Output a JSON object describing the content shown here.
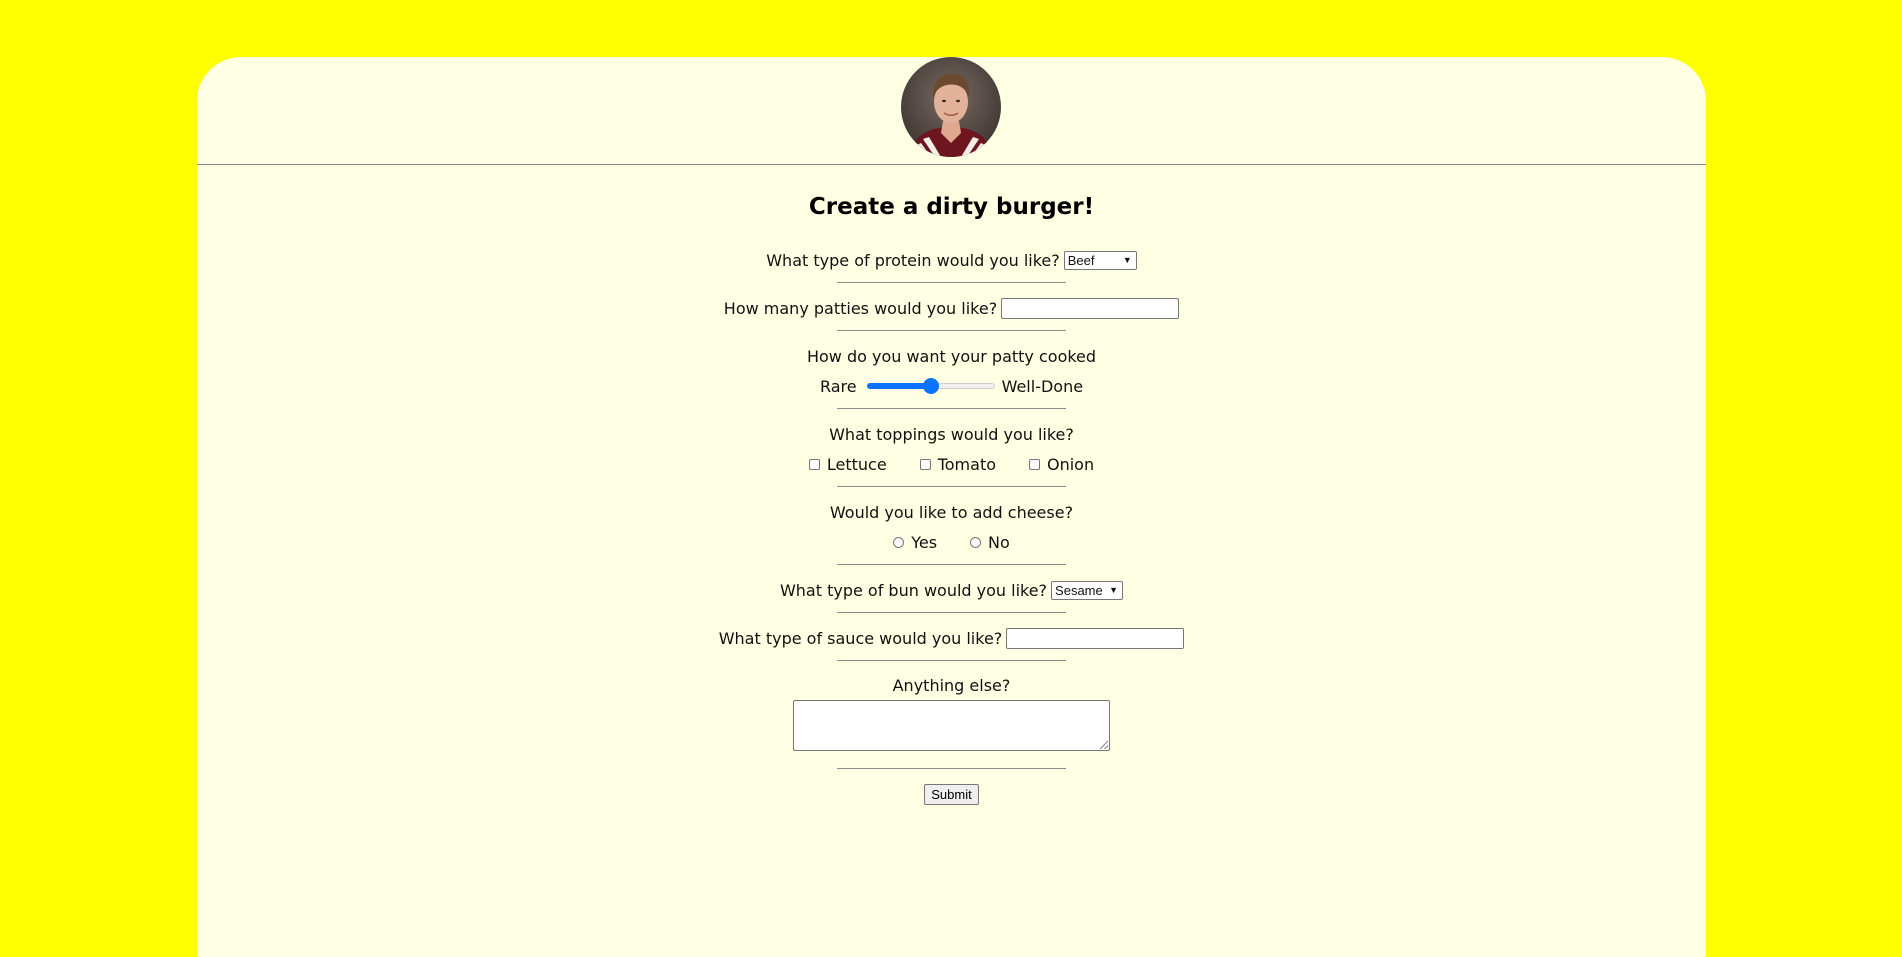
{
  "page": {
    "background_color": "#ffff00",
    "card_color": "#ffffe3",
    "accent_color": "#0b74ff"
  },
  "header": {
    "avatar_icon": "profile-photo"
  },
  "form": {
    "title": "Create a dirty burger!",
    "protein": {
      "label": "What type of protein would you like?",
      "selected": "Beef"
    },
    "patties": {
      "label": "How many patties would you like?",
      "value": ""
    },
    "cook": {
      "label": "How do you want your patty cooked",
      "min_label": "Rare",
      "max_label": "Well-Done",
      "level": 0.5
    },
    "toppings": {
      "label": "What toppings would you like?",
      "options": [
        "Lettuce",
        "Tomato",
        "Onion"
      ]
    },
    "cheese": {
      "label": "Would you like to add cheese?",
      "options": [
        "Yes",
        "No"
      ]
    },
    "bun": {
      "label": "What type of bun would you like?",
      "selected": "Sesame"
    },
    "sauce": {
      "label": "What type of sauce would you like?",
      "value": ""
    },
    "extra": {
      "label": "Anything else?",
      "value": ""
    },
    "submit_label": "Submit"
  }
}
